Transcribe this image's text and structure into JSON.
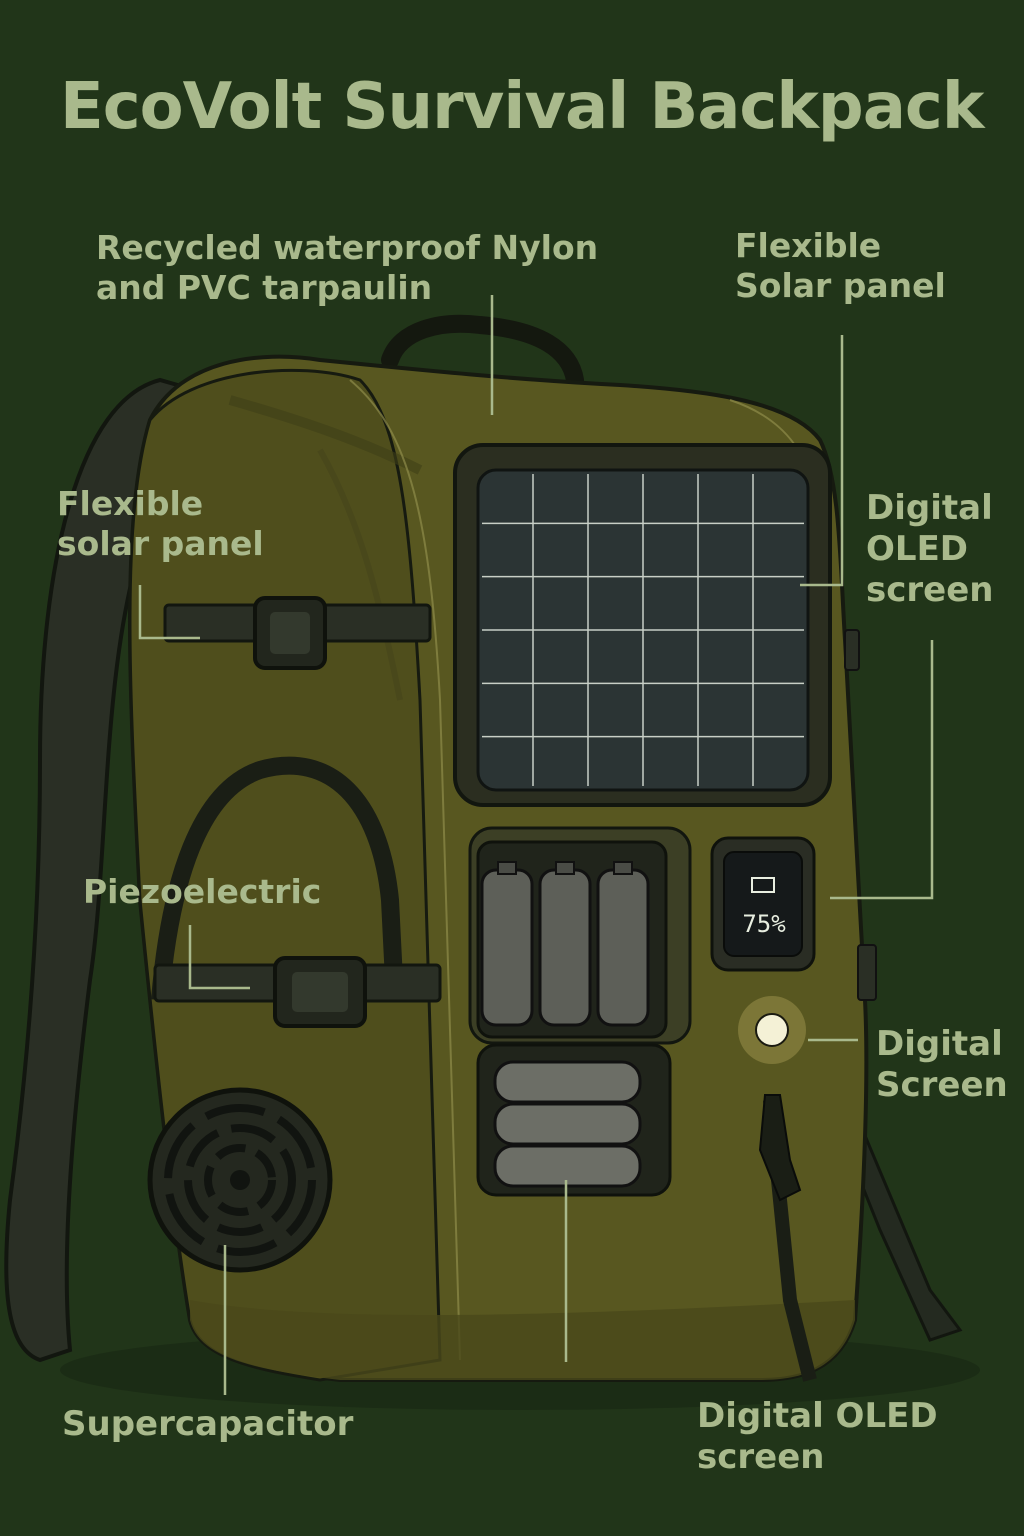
{
  "title": "EcoVolt Survival Backpack",
  "labels": {
    "material": "Recycled waterproof Nylon\nand PVC tarpaulin",
    "solar_top": "Flexible\nSolar panel",
    "solar_left": "Flexible\nsolar panel",
    "oled_right": "Digital\nOLED\nscreen",
    "piezo": "Piezoelectric",
    "digital_screen": "Digital\nScreen",
    "supercap": "Supercapacitor",
    "oled_bottom": "Digital OLED\nscreen"
  },
  "display": {
    "battery_percent": "75%"
  },
  "colors": {
    "background": "#213519",
    "backpack_body": "#5b5a21",
    "text": "#a9b98c",
    "solar_cell": "#2b3434",
    "led": "#f4f1d6"
  }
}
